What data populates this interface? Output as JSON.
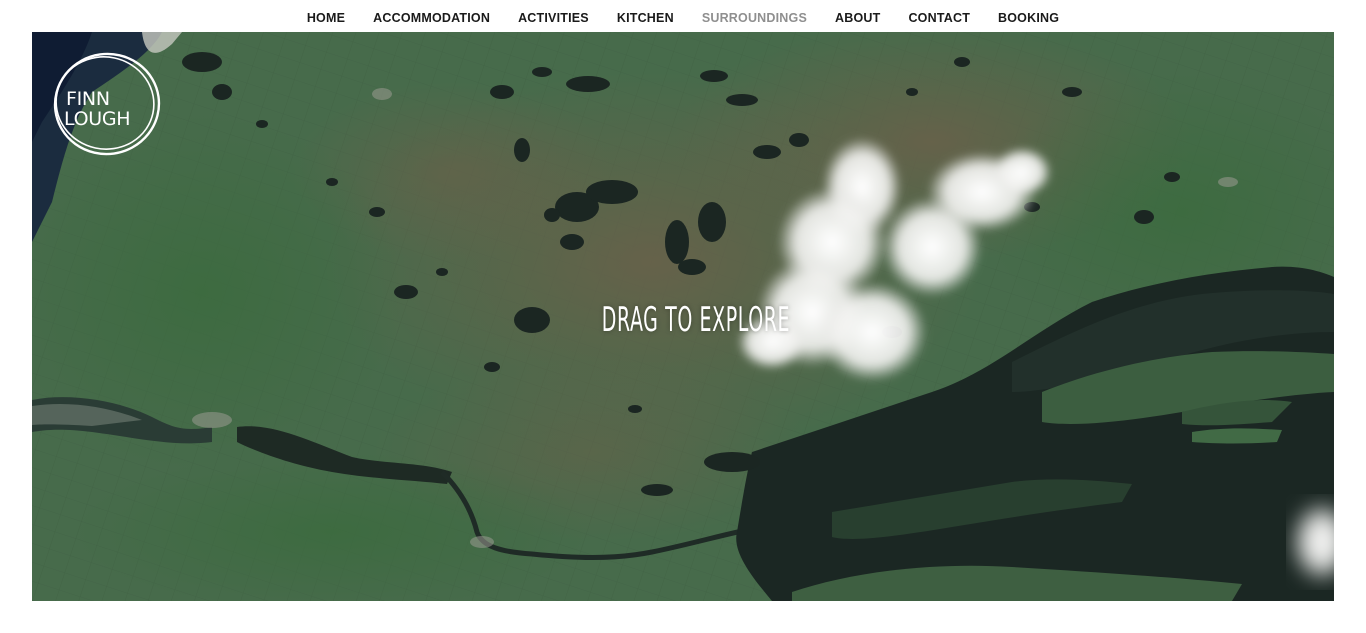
{
  "nav": {
    "items": [
      {
        "label": "HOME",
        "active": false
      },
      {
        "label": "ACCOMMODATION",
        "active": false
      },
      {
        "label": "ACTIVITIES",
        "active": false
      },
      {
        "label": "KITCHEN",
        "active": false
      },
      {
        "label": "SURROUNDINGS",
        "active": true
      },
      {
        "label": "ABOUT",
        "active": false
      },
      {
        "label": "CONTACT",
        "active": false
      },
      {
        "label": "BOOKING",
        "active": false
      }
    ],
    "active_color": "#8f8f8f",
    "text_color": "#1a1a1a"
  },
  "logo": {
    "line1": "FINN",
    "line2": "LOUGH"
  },
  "map": {
    "overlay_text": "DRAG TO EXPLORE",
    "land_color": "#4a6a4c",
    "water_color": "#1c2a26"
  }
}
